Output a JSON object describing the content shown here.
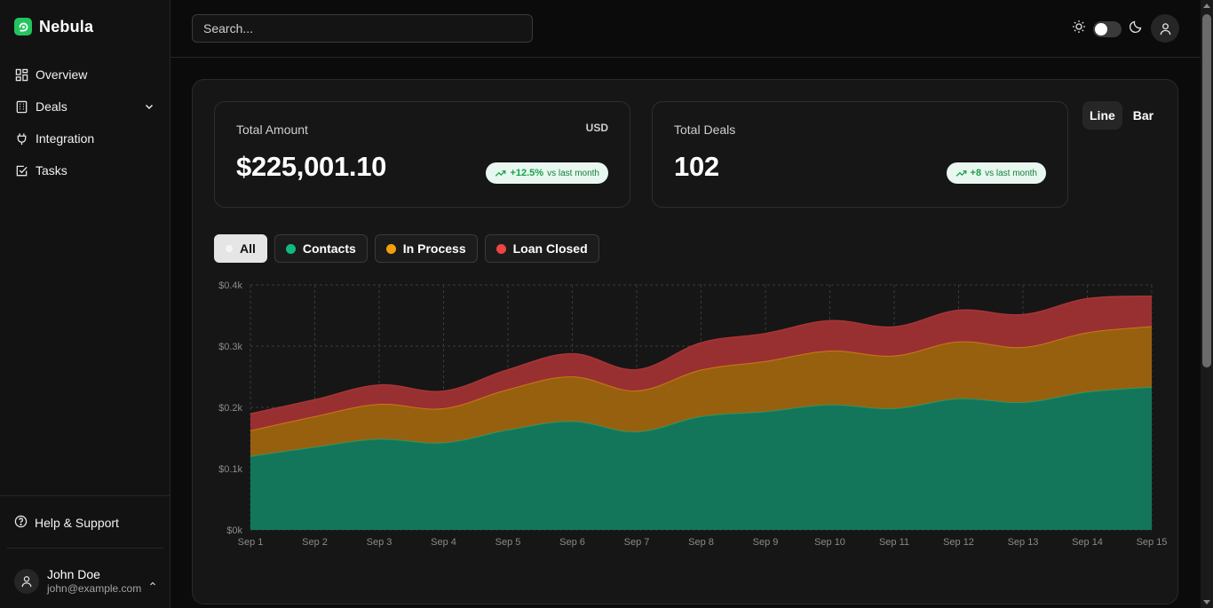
{
  "brand": {
    "name": "Nebula"
  },
  "nav": {
    "items": [
      {
        "label": "Overview",
        "icon": "grid-icon"
      },
      {
        "label": "Deals",
        "icon": "building-icon",
        "expandable": true
      },
      {
        "label": "Integration",
        "icon": "plug-icon"
      },
      {
        "label": "Tasks",
        "icon": "checkbox-icon"
      }
    ],
    "help": "Help & Support"
  },
  "user": {
    "name": "John Doe",
    "email": "john@example.com"
  },
  "search": {
    "placeholder": "Search..."
  },
  "stats": {
    "amount": {
      "label": "Total Amount",
      "currency": "USD",
      "value": "$225,001.10",
      "change": "+12.5%",
      "change_sub": "vs last month"
    },
    "deals": {
      "label": "Total Deals",
      "value": "102",
      "change": "+8",
      "change_sub": "vs last month"
    }
  },
  "view_toggle": {
    "line": "Line",
    "bar": "Bar",
    "active": "Line"
  },
  "filters": [
    {
      "label": "All",
      "color": "#e5e5e5",
      "active": true
    },
    {
      "label": "Contacts",
      "color": "#10b981",
      "active": false
    },
    {
      "label": "In Process",
      "color": "#f59e0b",
      "active": false
    },
    {
      "label": "Loan Closed",
      "color": "#ef4444",
      "active": false
    }
  ],
  "colors": {
    "accent": "#22c55e",
    "contacts": "#10b981",
    "in_process": "#f59e0b",
    "loan_closed": "#ef4444"
  },
  "chart_data": {
    "type": "area",
    "stacked": true,
    "x": [
      "Sep 1",
      "Sep 2",
      "Sep 3",
      "Sep 4",
      "Sep 5",
      "Sep 6",
      "Sep 7",
      "Sep 8",
      "Sep 9",
      "Sep 10",
      "Sep 11",
      "Sep 12",
      "Sep 13",
      "Sep 14",
      "Sep 15"
    ],
    "yticks": [
      "$0k",
      "$0.1k",
      "$0.2k",
      "$0.3k",
      "$0.4k"
    ],
    "ylim": [
      0,
      400
    ],
    "grid": true,
    "series": [
      {
        "name": "Contacts",
        "color": "#10b981",
        "values": [
          120,
          135,
          148,
          142,
          163,
          177,
          160,
          185,
          193,
          204,
          198,
          214,
          208,
          225,
          233
        ]
      },
      {
        "name": "In Process",
        "color": "#f59e0b",
        "values": [
          42,
          50,
          57,
          56,
          66,
          73,
          67,
          76,
          82,
          88,
          86,
          93,
          90,
          97,
          99
        ]
      },
      {
        "name": "Loan Closed",
        "color": "#ef4444",
        "values": [
          28,
          28,
          32,
          29,
          33,
          38,
          35,
          45,
          46,
          50,
          48,
          52,
          54,
          56,
          50
        ]
      }
    ]
  }
}
